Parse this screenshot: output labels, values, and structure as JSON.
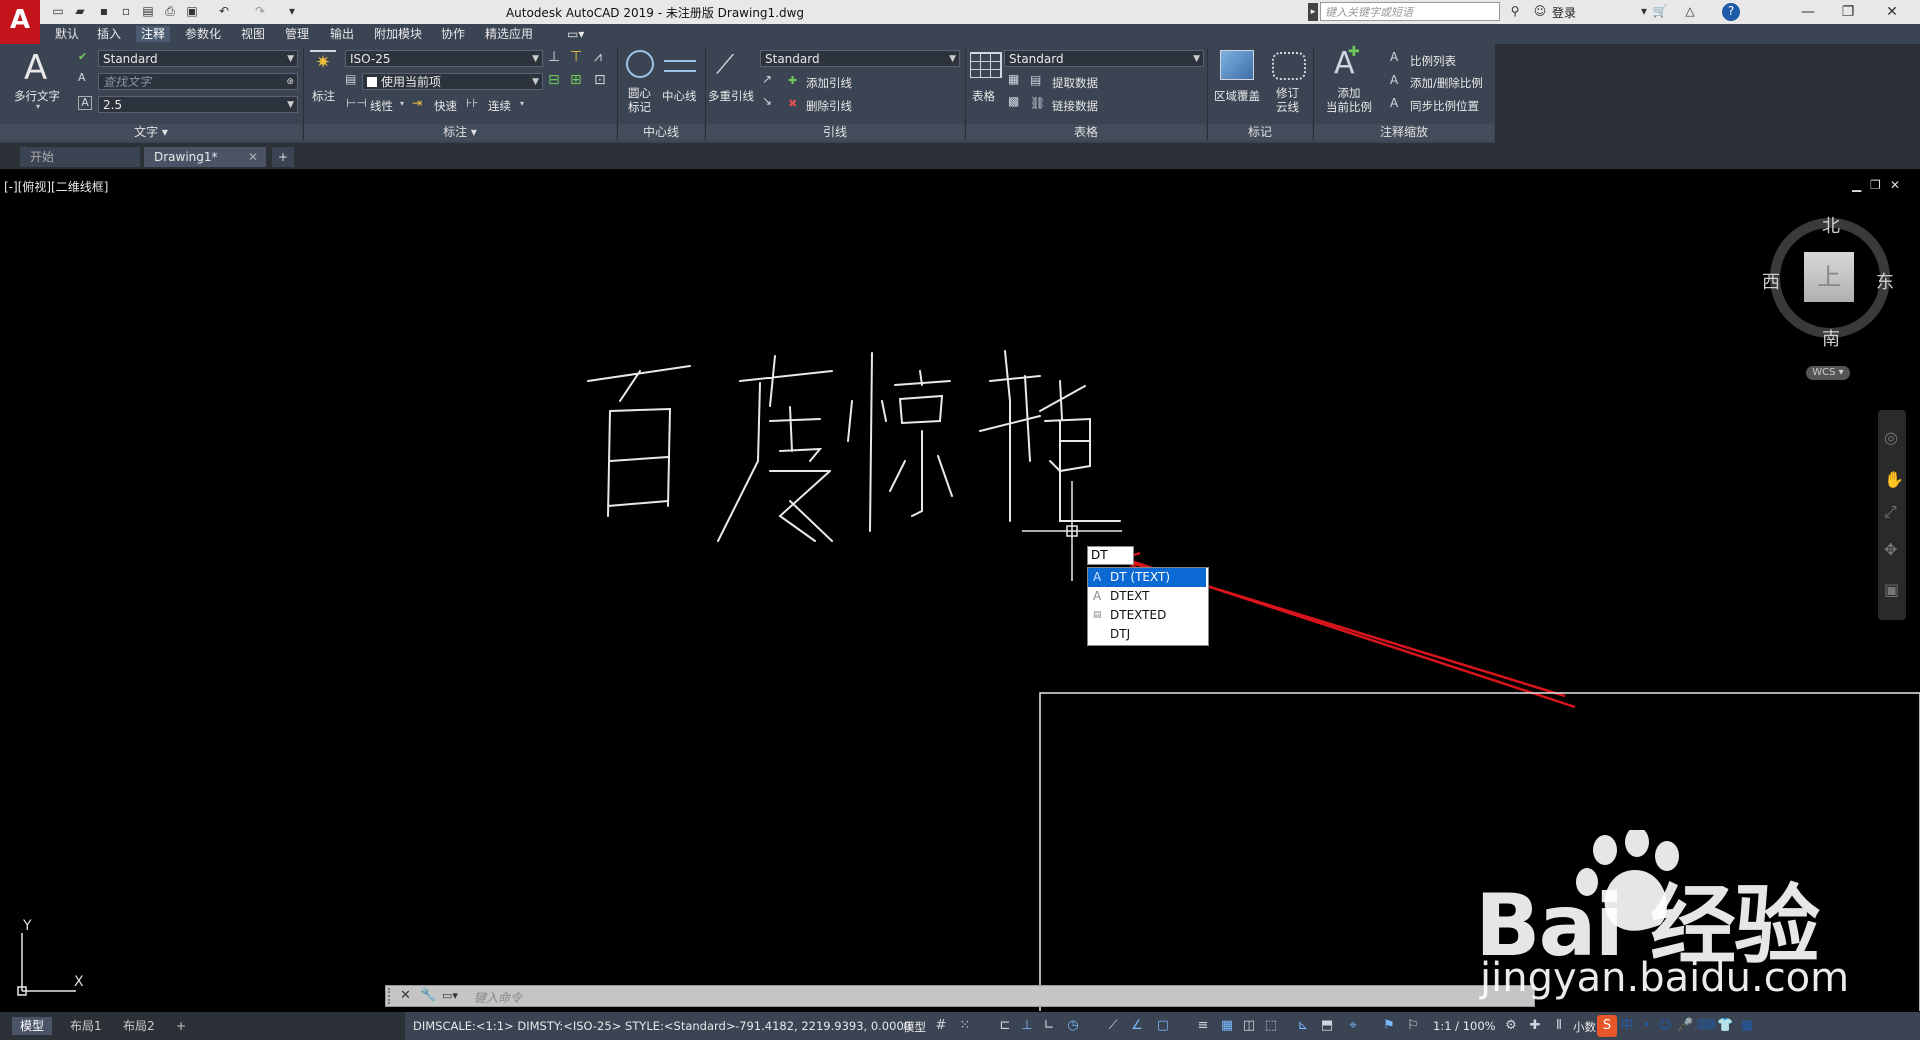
{
  "window": {
    "title": "Autodesk AutoCAD 2019 - 未注册版    Drawing1.dwg",
    "search_placeholder": "键入关键字或短语",
    "login_label": "登录"
  },
  "menu_tabs": [
    "默认",
    "插入",
    "注释",
    "参数化",
    "视图",
    "管理",
    "输出",
    "附加模块",
    "协作",
    "精选应用"
  ],
  "active_tab": "注释",
  "ribbon": {
    "text_panel": {
      "mtext_label": "多行文字",
      "style_value": "Standard",
      "find_placeholder": "查找文字",
      "height_value": "2.5",
      "panel_label": "文字"
    },
    "dim_panel": {
      "dim_label": "标注",
      "style_value": "ISO-25",
      "layer_value": "使用当前项",
      "linear_label": "线性",
      "quick_label": "快速",
      "continue_label": "连续",
      "panel_label": "标注"
    },
    "centerline_panel": {
      "center_mark_label": "圆心\n标记",
      "centerline_label": "中心线",
      "panel_label": "中心线"
    },
    "leader_panel": {
      "mleader_label": "多重引线",
      "style_value": "Standard",
      "add_leader": "添加引线",
      "remove_leader": "删除引线",
      "panel_label": "引线"
    },
    "table_panel": {
      "table_label": "表格",
      "style_value": "Standard",
      "extract_data": "提取数据",
      "link_data": "链接数据",
      "panel_label": "表格"
    },
    "markup_panel": {
      "wipeout_label": "区域覆盖",
      "revcloud_label": "修订\n云线",
      "panel_label": "标记"
    },
    "scale_panel": {
      "add_scale_label": "添加\n当前比例",
      "scale_list": "比例列表",
      "add_delete_scale": "添加/删除比例",
      "sync_scale": "同步比例位置",
      "panel_label": "注释缩放"
    }
  },
  "file_tabs": [
    "开始",
    "Drawing1*"
  ],
  "viewport": {
    "label": "[-][俯视][二维线框]",
    "drawn_text": "百度惊艳",
    "compass": {
      "north": "北",
      "south": "南",
      "east": "东",
      "west": "西",
      "top": "上"
    },
    "wcs_label": "WCS",
    "axis_x": "X",
    "axis_y": "Y"
  },
  "autocomplete": {
    "typed": "DT",
    "items": [
      "DT (TEXT)",
      "DTEXT",
      "DTEXTED",
      "DTJ"
    ],
    "selected_index": 0
  },
  "command_line": {
    "placeholder": "键入命令"
  },
  "layout_tabs": [
    "模型",
    "布局1",
    "布局2"
  ],
  "status": {
    "dim_info": "DIMSCALE:<1:1> DIMSTY:<ISO-25> STYLE:<Standard>",
    "coords": "-791.4182, 2219.9393, 0.0000",
    "model_label": "模型",
    "scale": "1:1 / 100%",
    "units": "小数"
  },
  "watermark": {
    "logo": "Bai 经验",
    "url": "jingyan.baidu.com"
  },
  "colors": {
    "ribbon_bg": "#3b4453",
    "selection": "#0b69d4",
    "annotation_arrow": "#d8141c"
  }
}
